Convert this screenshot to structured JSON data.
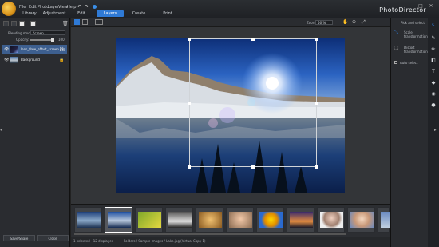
{
  "app": {
    "title": "PhotoDirector"
  },
  "menu": [
    "File",
    "Edit",
    "Photo",
    "Layer",
    "View",
    "Help"
  ],
  "tabs": [
    {
      "label": "Library",
      "active": false
    },
    {
      "label": "Adjustment",
      "active": false
    },
    {
      "label": "Edit",
      "active": false
    },
    {
      "label": "Layers",
      "active": true
    },
    {
      "label": "Create",
      "active": false
    },
    {
      "label": "Print",
      "active": false
    }
  ],
  "left_panel": {
    "blending_label": "Blending mode:",
    "blending_value": "Screen",
    "opacity_label": "Opacity:",
    "opacity_value": "100",
    "layers": [
      {
        "name": "lens_flare_effect_screen.jpg",
        "selected": true
      },
      {
        "name": "Background",
        "selected": false
      }
    ],
    "save_label": "Save/Share",
    "close_label": "Close"
  },
  "toolbar": {
    "zoom_label": "Zoom:",
    "zoom_value": "56 %"
  },
  "right_panel": {
    "header": "Pick and select",
    "scale_label": "Scale transformation",
    "distort_label": "Distort transformation",
    "auto_select_label": "Auto select"
  },
  "filmstrip": {
    "status_selected": "1 selected - 12 displayed",
    "status_path": "Folders / Sample Images / Lake.jpg (Virtual Copy 1)",
    "selected_index": 1
  },
  "colors": {
    "accent": "#2f7ad6",
    "panel": "#2a2c30"
  }
}
